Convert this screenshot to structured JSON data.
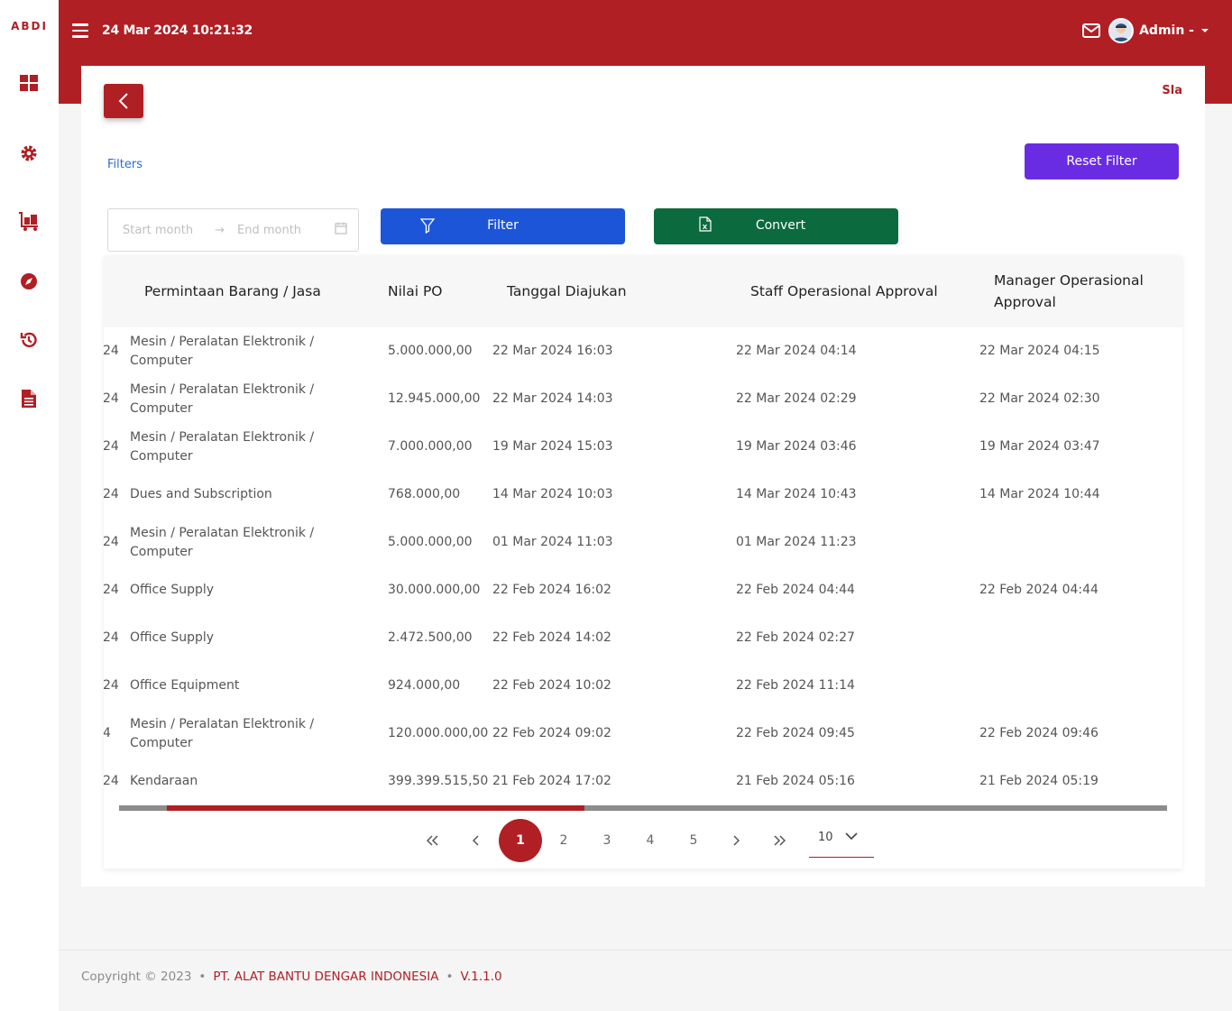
{
  "brand": "ABDI",
  "header": {
    "datetime": "24 Mar 2024 10:21:32",
    "user_name": "Admin -"
  },
  "sidebar": {
    "icons": [
      "dashboard-icon",
      "gear-icon",
      "luggage-cart-icon",
      "compass-icon",
      "history-icon",
      "document-icon"
    ]
  },
  "page": {
    "corner_text": "Sla",
    "filters_label": "Filters",
    "reset_label": "Reset Filter",
    "start_placeholder": "Start month",
    "end_placeholder": "End month",
    "filter_label": "Filter",
    "convert_label": "Convert"
  },
  "table": {
    "headers": [
      "Permintaan Barang / Jasa",
      "Nilai PO",
      "Tanggal Diajukan",
      "Staff Operasional Approval",
      "Manager Operasional Approval"
    ],
    "rows": [
      {
        "cut": "24",
        "item": "Mesin / Peralatan Elektronik / Computer",
        "nilai": "5.000.000,00",
        "diajukan": "22 Mar 2024 16:03",
        "staff": "22 Mar 2024 04:14",
        "manager": "22 Mar 2024 04:15"
      },
      {
        "cut": "24",
        "item": "Mesin / Peralatan Elektronik / Computer",
        "nilai": "12.945.000,00",
        "diajukan": "22 Mar 2024 14:03",
        "staff": "22 Mar 2024 02:29",
        "manager": "22 Mar 2024 02:30"
      },
      {
        "cut": "24",
        "item": "Mesin / Peralatan Elektronik / Computer",
        "nilai": "7.000.000,00",
        "diajukan": "19 Mar 2024 15:03",
        "staff": "19 Mar 2024 03:46",
        "manager": "19 Mar 2024 03:47"
      },
      {
        "cut": "24",
        "item": "Dues and Subscription",
        "nilai": "768.000,00",
        "diajukan": "14 Mar 2024 10:03",
        "staff": "14 Mar 2024 10:43",
        "manager": "14 Mar 2024 10:44"
      },
      {
        "cut": "24",
        "item": "Mesin / Peralatan Elektronik / Computer",
        "nilai": "5.000.000,00",
        "diajukan": "01 Mar 2024 11:03",
        "staff": "01 Mar 2024 11:23",
        "manager": ""
      },
      {
        "cut": "24",
        "item": "Office Supply",
        "nilai": "30.000.000,00",
        "diajukan": "22 Feb 2024 16:02",
        "staff": "22 Feb 2024 04:44",
        "manager": "22 Feb 2024 04:44"
      },
      {
        "cut": "24",
        "item": "Office Supply",
        "nilai": "2.472.500,00",
        "diajukan": "22 Feb 2024 14:02",
        "staff": "22 Feb 2024 02:27",
        "manager": ""
      },
      {
        "cut": "24",
        "item": "Office Equipment",
        "nilai": "924.000,00",
        "diajukan": "22 Feb 2024 10:02",
        "staff": "22 Feb 2024 11:14",
        "manager": ""
      },
      {
        "cut": "4",
        "item": "Mesin / Peralatan Elektronik / Computer",
        "nilai": "120.000.000,00",
        "diajukan": "22 Feb 2024 09:02",
        "staff": "22 Feb 2024 09:45",
        "manager": "22 Feb 2024 09:46"
      },
      {
        "cut": "24",
        "item": "Kendaraan",
        "nilai": "399.399.515,50",
        "diajukan": "21 Feb 2024 17:02",
        "staff": "21 Feb 2024 05:16",
        "manager": "21 Feb 2024 05:19"
      }
    ]
  },
  "pagination": {
    "pages": [
      "1",
      "2",
      "3",
      "4",
      "5"
    ],
    "active": "1",
    "page_size": "10"
  },
  "footer": {
    "copyright": "Copyright © 2023",
    "company": "PT. ALAT BANTU DENGAR INDONESIA",
    "version": "V.1.1.0"
  },
  "colors": {
    "primary": "#b01f24",
    "reset": "#6a2ce2",
    "filter": "#1d55d8",
    "convert": "#0b6b3f"
  }
}
